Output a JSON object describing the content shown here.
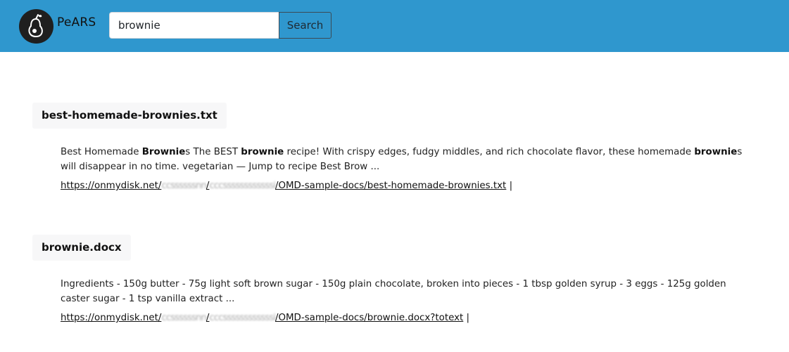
{
  "header": {
    "brand": "PeARS",
    "search_value": "brownie",
    "search_button": "Search",
    "logo_icon": "pear-logo-icon",
    "bar_color": "#2f97ce"
  },
  "results": [
    {
      "title": "best-homemade-brownies.txt",
      "snippet_parts": [
        {
          "t": "Best Homemade ",
          "b": false
        },
        {
          "t": "Brownie",
          "b": true
        },
        {
          "t": "s The BEST ",
          "b": false
        },
        {
          "t": "brownie",
          "b": true
        },
        {
          "t": " recipe! With crispy edges, fudgy middles, and rich chocolate flavor, these homemade ",
          "b": false
        },
        {
          "t": "brownie",
          "b": true
        },
        {
          "t": "s will disappear in no time. vegetarian — Jump to recipe Best Brow ...",
          "b": false
        }
      ],
      "url_prefix": "https://onmydisk.net/",
      "url_blur_1": "ccssssssnn",
      "url_sep": "/",
      "url_blur_2": "cccssssssssssssi",
      "url_suffix": "/OMD-sample-docs/best-homemade-brownies.txt",
      "trailing": " |"
    },
    {
      "title": "brownie.docx",
      "snippet_parts": [
        {
          "t": "Ingredients - 150g butter - 75g light soft brown sugar - 150g plain chocolate, broken into pieces - 1 tbsp golden syrup - 3 eggs - 125g golden caster sugar - 1 tsp vanilla extract ...",
          "b": false
        }
      ],
      "url_prefix": "https://onmydisk.net/",
      "url_blur_1": "ccssssssnn",
      "url_sep": "/",
      "url_blur_2": "cccssssssssssssi",
      "url_suffix": "/OMD-sample-docs/brownie.docx?totext",
      "trailing": " |"
    }
  ]
}
